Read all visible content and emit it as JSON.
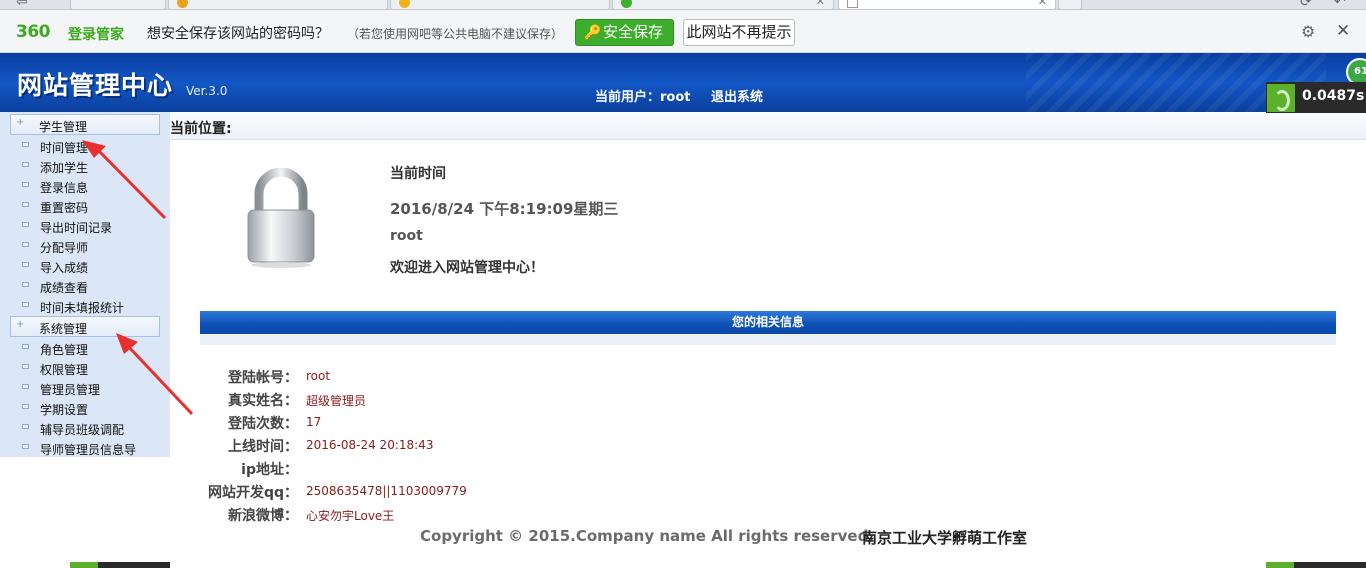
{
  "password_bar": {
    "logo": "360",
    "logo_label": "登录管家",
    "question": "想安全保存该网站的密码吗？",
    "hint": "（若您使用网吧等公共电脑不建议保存）",
    "save_button": "安全保存",
    "never_button": "此网站不再提示"
  },
  "header": {
    "title": "网站管理中心",
    "version": "Ver.3.0",
    "current_user": "当前用户：root",
    "logout": "退出系统"
  },
  "speed_widget": {
    "value": "0.0487s",
    "circle": "61"
  },
  "sidebar": {
    "groups": [
      {
        "label": "学生管理",
        "items": [
          "时间管理",
          "添加学生",
          "登录信息",
          "重置密码",
          "导出时间记录",
          "分配导师",
          "导入成绩",
          "成绩查看",
          "时间未填报统计"
        ]
      },
      {
        "label": "系统管理",
        "items": [
          "角色管理",
          "权限管理",
          "管理员管理",
          "学期设置",
          "辅导员班级调配",
          "导师管理员信息导"
        ]
      }
    ]
  },
  "breadcrumb": {
    "label": "当前位置:"
  },
  "main": {
    "time_label": "当前时间",
    "time_value": "2016/8/24 下午8:19:09星期三",
    "user": "root",
    "welcome": "欢迎进入网站管理中心！",
    "info_title": "您的相关信息",
    "info_rows": [
      {
        "key": "登陆帐号：",
        "value": "root"
      },
      {
        "key": "真实姓名：",
        "value": "超级管理员"
      },
      {
        "key": "登陆次数：",
        "value": "17"
      },
      {
        "key": "上线时间：",
        "value": "2016-08-24 20:18:43"
      },
      {
        "key": "ip地址：",
        "value": ""
      },
      {
        "key": "网站开发qq：",
        "value": "2508635478||1103009779"
      },
      {
        "key": "新浪微博：",
        "value": "心安勿宇Love王"
      }
    ]
  },
  "footer": {
    "copyright": "Copyright © 2015.Company name All rights reserved.",
    "studio": "南京工业大学孵萌工作室"
  },
  "colors": {
    "header_blue": "#1257c5",
    "save_green": "#3cae2c",
    "sidebar_bg": "#dbe7f6",
    "value_red": "#8b1a1a",
    "arrow_red": "#e8312f"
  }
}
